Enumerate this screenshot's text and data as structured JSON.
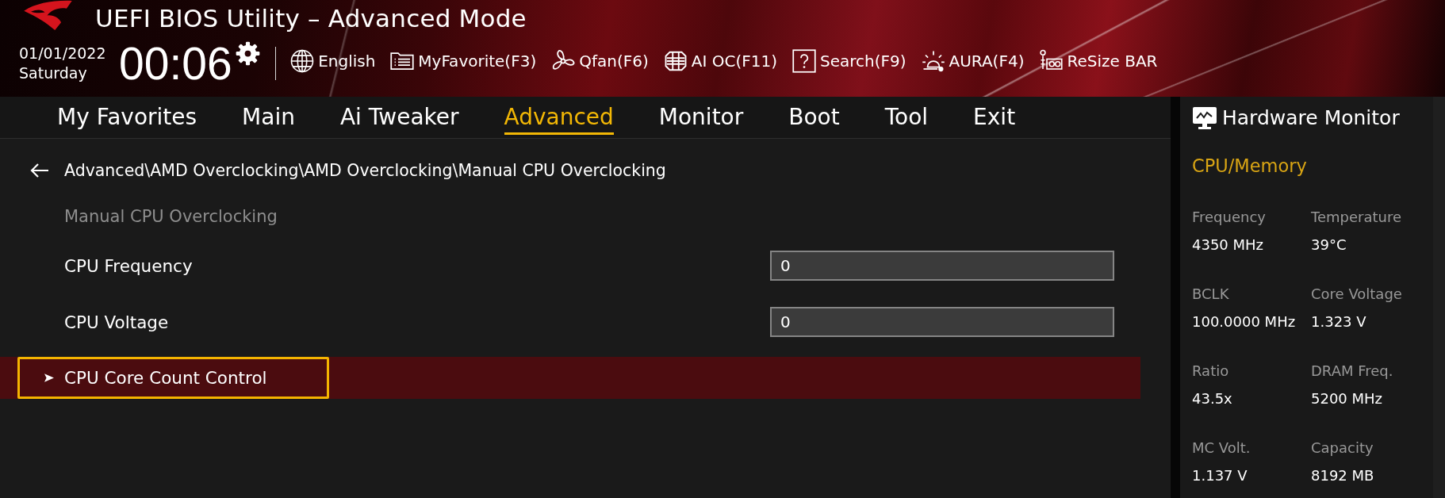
{
  "header": {
    "title": "UEFI BIOS Utility – Advanced Mode",
    "date": "01/01/2022",
    "day": "Saturday",
    "time": "00:06",
    "toolbar": [
      {
        "kind": "globe",
        "label": "English"
      },
      {
        "kind": "favorites",
        "label": "MyFavorite(F3)"
      },
      {
        "kind": "fan",
        "label": "Qfan(F6)"
      },
      {
        "kind": "aioc",
        "label": "AI OC(F11)"
      },
      {
        "kind": "search",
        "label": "Search(F9)"
      },
      {
        "kind": "aura",
        "label": "AURA(F4)"
      },
      {
        "kind": "resizebar",
        "label": "ReSize BAR"
      }
    ]
  },
  "tabs": [
    {
      "label": "My Favorites",
      "selected": false
    },
    {
      "label": "Main",
      "selected": false
    },
    {
      "label": "Ai Tweaker",
      "selected": false
    },
    {
      "label": "Advanced",
      "selected": true
    },
    {
      "label": "Monitor",
      "selected": false
    },
    {
      "label": "Boot",
      "selected": false
    },
    {
      "label": "Tool",
      "selected": false
    },
    {
      "label": "Exit",
      "selected": false
    }
  ],
  "breadcrumb": "Advanced\\AMD Overclocking\\AMD Overclocking\\Manual CPU Overclocking",
  "section_title": "Manual CPU Overclocking",
  "settings": [
    {
      "kind": "input",
      "label": "CPU Frequency",
      "value": "0",
      "selected": false
    },
    {
      "kind": "input",
      "label": "CPU Voltage",
      "value": "0",
      "selected": false
    },
    {
      "kind": "submenu",
      "label": "CPU Core Count Control",
      "selected": true
    }
  ],
  "hardware_monitor": {
    "title": "Hardware Monitor",
    "section": "CPU/Memory",
    "readings": [
      {
        "label": "Frequency",
        "value": "4350 MHz"
      },
      {
        "label": "Temperature",
        "value": "39°C"
      },
      {
        "label": "BCLK",
        "value": "100.0000 MHz"
      },
      {
        "label": "Core Voltage",
        "value": "1.323 V"
      },
      {
        "label": "Ratio",
        "value": "43.5x"
      },
      {
        "label": "DRAM Freq.",
        "value": "5200 MHz"
      },
      {
        "label": "MC Volt.",
        "value": "1.137 V"
      },
      {
        "label": "Capacity",
        "value": "8192 MB"
      }
    ]
  }
}
